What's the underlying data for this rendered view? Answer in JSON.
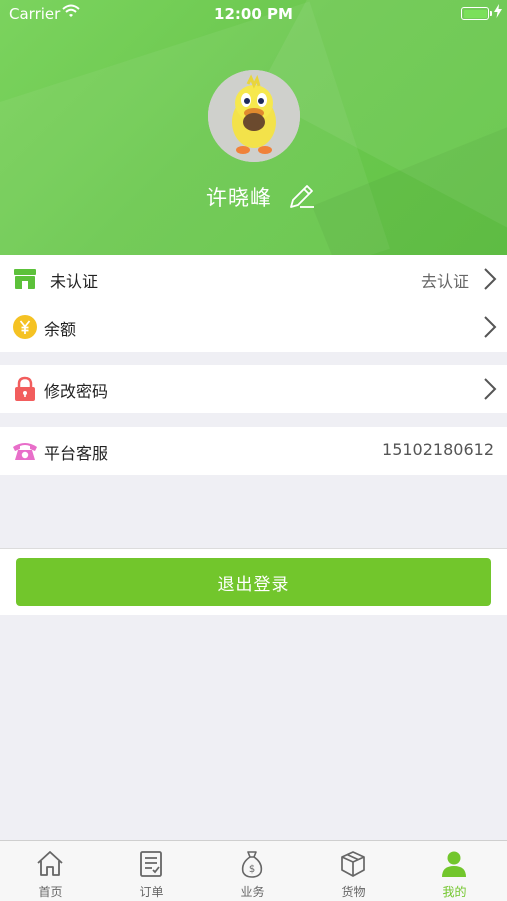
{
  "status_bar": {
    "carrier": "Carrier",
    "time": "12:00 PM"
  },
  "profile": {
    "username": "许晓峰"
  },
  "menu": {
    "verify": {
      "label": "未认证",
      "action": "去认证"
    },
    "balance": {
      "label": "余额"
    },
    "password": {
      "label": "修改密码"
    },
    "service": {
      "label": "平台客服",
      "phone": "15102180612"
    }
  },
  "logout_label": "退出登录",
  "tabs": [
    {
      "label": "首页",
      "icon": "home-icon"
    },
    {
      "label": "订单",
      "icon": "order-list-icon"
    },
    {
      "label": "业务",
      "icon": "money-bag-icon"
    },
    {
      "label": "货物",
      "icon": "box-icon"
    },
    {
      "label": "我的",
      "icon": "person-icon"
    }
  ],
  "colors": {
    "accent": "#72c62c",
    "header": "#6cc84f",
    "background": "#efeff4"
  }
}
